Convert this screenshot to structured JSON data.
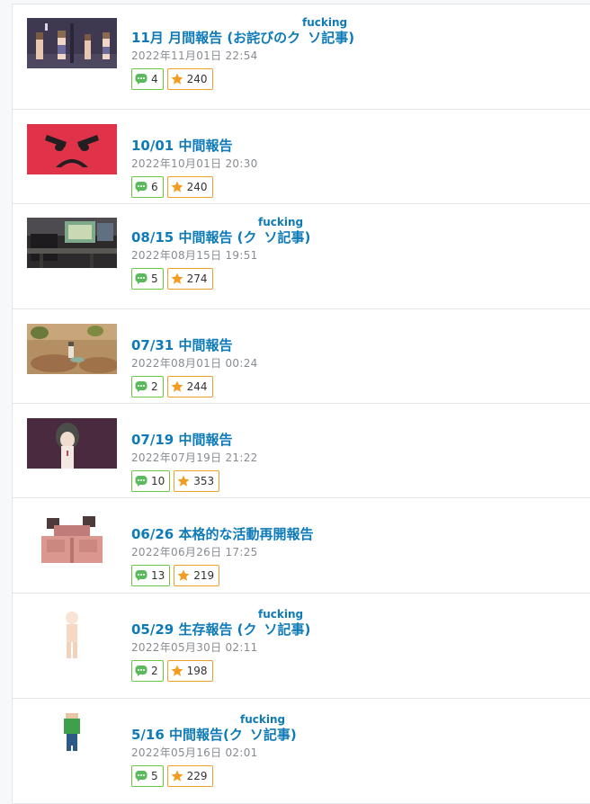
{
  "colors": {
    "title": "#0e7bb8",
    "date": "#888c91",
    "comment_border": "#6cc644",
    "star_border": "#f0a02a",
    "star_fill": "#f39c1f",
    "comment_fill": "#5cb85c"
  },
  "icons": {
    "comment": "speech-bubble-icon",
    "star": "star-icon"
  },
  "posts": [
    {
      "title": "11月 月間報告 (お詫びのクソ記事)",
      "title_parts": [
        "11月 月間報告 (お詫びのク",
        "ソ記事)"
      ],
      "ruby": "fucking",
      "date": "2022年11月01日 22:54",
      "comments": "4",
      "stars": "240",
      "thumb": "pixel-characters"
    },
    {
      "title": "10/01 中間報告",
      "title_parts": [
        "10/01 中間報告",
        ""
      ],
      "ruby": "",
      "date": "2022年10月01日 20:30",
      "comments": "6",
      "stars": "240",
      "thumb": "angry-face"
    },
    {
      "title": "08/15 中間報告 (クソ記事)",
      "title_parts": [
        "08/15 中間報告 (ク",
        "ソ記事)"
      ],
      "ruby": "fucking",
      "date": "2022年08月15日 19:51",
      "comments": "5",
      "stars": "274",
      "thumb": "computer-desk"
    },
    {
      "title": "07/31 中間報告",
      "title_parts": [
        "07/31 中間報告",
        ""
      ],
      "ruby": "",
      "date": "2022年08月01日 00:24",
      "comments": "2",
      "stars": "244",
      "thumb": "desert-scene"
    },
    {
      "title": "07/19 中間報告",
      "title_parts": [
        "07/19 中間報告",
        ""
      ],
      "ruby": "",
      "date": "2022年07月19日 21:22",
      "comments": "10",
      "stars": "353",
      "thumb": "character-portrait"
    },
    {
      "title": "06/26 本格的な活動再開報告",
      "title_parts": [
        "06/26 本格的な活動再開報告",
        ""
      ],
      "ruby": "",
      "date": "2022年06月26日 17:25",
      "comments": "13",
      "stars": "219",
      "thumb": "pixel-back"
    },
    {
      "title": "05/29 生存報告 (クソ記事)",
      "title_parts": [
        "05/29 生存報告 (ク",
        "ソ記事)"
      ],
      "ruby": "fucking",
      "date": "2022年05月30日 02:11",
      "comments": "2",
      "stars": "198",
      "thumb": "pixel-figure"
    },
    {
      "title": "5/16 中間報告(クソ記事)",
      "title_parts": [
        "5/16 中間報告(ク",
        "ソ記事)"
      ],
      "ruby": "fucking",
      "date": "2022年05月16日 02:01",
      "comments": "5",
      "stars": "229",
      "thumb": "pixel-green-figure"
    }
  ]
}
